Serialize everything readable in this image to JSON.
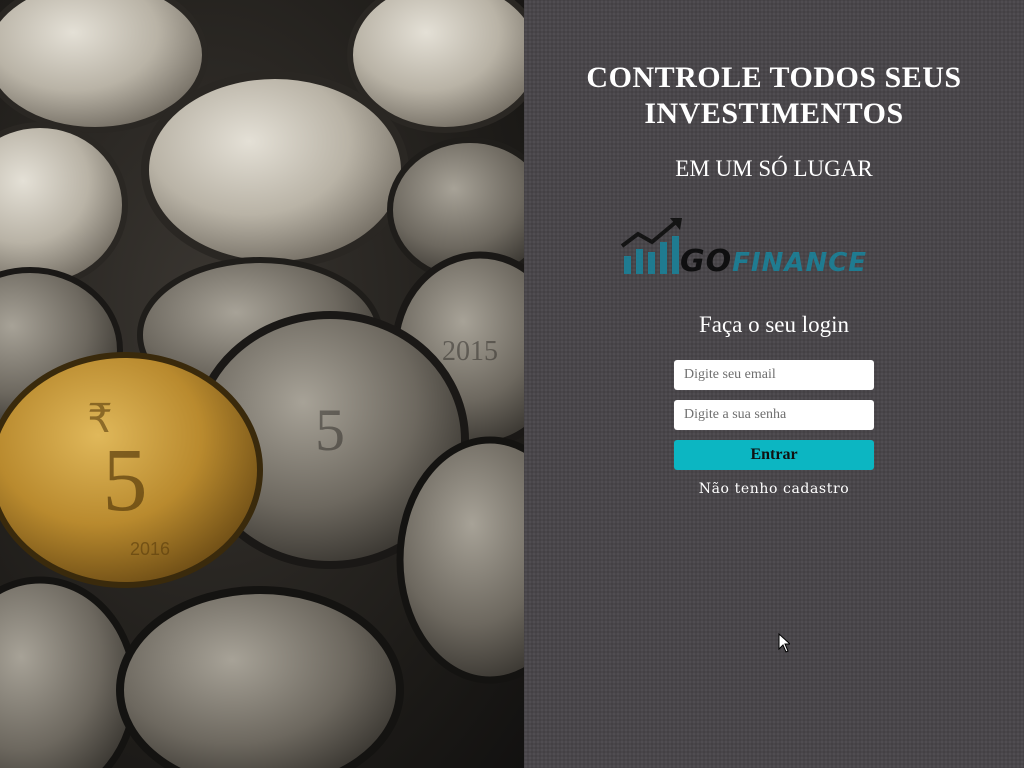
{
  "hero": {
    "headline_line1": "CONTROLE TODOS SEUS",
    "headline_line2": "INVESTIMENTOS",
    "subheadline": "EM UM SÓ LUGAR"
  },
  "logo": {
    "text_go": "GO",
    "text_finance": "FINANCE",
    "icon": "rising-bar-chart-icon"
  },
  "login": {
    "title": "Faça o seu login",
    "email_placeholder": "Digite seu email",
    "email_value": "",
    "password_placeholder": "Digite a sua senha",
    "password_value": "",
    "submit_label": "Entrar",
    "register_link": "Não tenho cadastro"
  },
  "colors": {
    "panel_background": "#49464a",
    "button_accent": "#0cb6c2",
    "logo_accent": "#1f7b90"
  },
  "background_image": {
    "description_icon": "coins-photo"
  }
}
